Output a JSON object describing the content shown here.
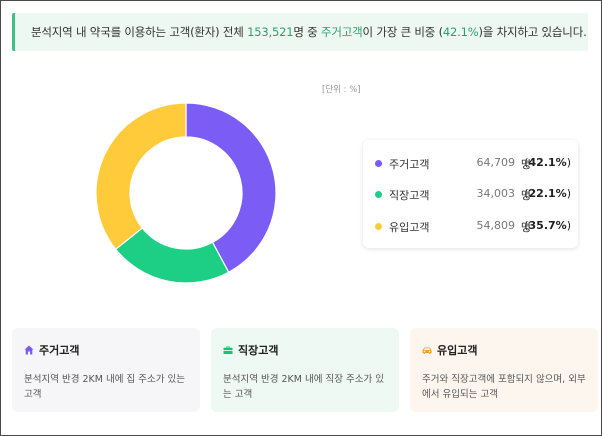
{
  "banner": {
    "prefix": "분석지역 내 약국를 이용하는 고객(환자) 전체 ",
    "total": "153,521",
    "mid": "명 중 ",
    "highlight_category": "주거고객",
    "mid2": "이 가장 큰 비중 (",
    "highlight_pct": "42.1%",
    "suffix": ")을 차지하고 있습니다."
  },
  "unit_label": "[단위 : %]",
  "chart_data": {
    "type": "pie",
    "donut": true,
    "categories": [
      "주거고객",
      "직장고객",
      "유입고객"
    ],
    "values": [
      42.1,
      22.1,
      35.7
    ],
    "counts": [
      "64,709",
      "34,003",
      "54,809"
    ],
    "colors": [
      "#7b5cf5",
      "#1ccf84",
      "#ffcb3b"
    ],
    "unit": "%",
    "legend_position": "right"
  },
  "legend": [
    {
      "label": "주거고객",
      "value": "64,709",
      "unit": "명",
      "pct": "42.1%",
      "color": "#7b5cf5"
    },
    {
      "label": "직장고객",
      "value": "34,003",
      "unit": "명",
      "pct": "22.1%",
      "color": "#1ccf84"
    },
    {
      "label": "유입고객",
      "value": "54,809",
      "unit": "명",
      "pct": "35.7%",
      "color": "#ffcb3b"
    }
  ],
  "cards": [
    {
      "title": "주거고객",
      "desc": "분석지역 반경 2KM 내에 집 주소가 있는 고객",
      "icon": "home-icon",
      "bg": "#f6f6f8",
      "icon_color": "#7b5cf5"
    },
    {
      "title": "직장고객",
      "desc": "분석지역 반경 2KM 내에 직장 주소가 있는 고객",
      "icon": "briefcase-icon",
      "bg": "#eef9f3",
      "icon_color": "#1fbf7a"
    },
    {
      "title": "유입고객",
      "desc": "주거와 직장고객에 포함되지 않으며, 외부에서 유입되는 고객",
      "icon": "car-icon",
      "bg": "#fdf6ef",
      "icon_color": "#f0a030"
    }
  ]
}
